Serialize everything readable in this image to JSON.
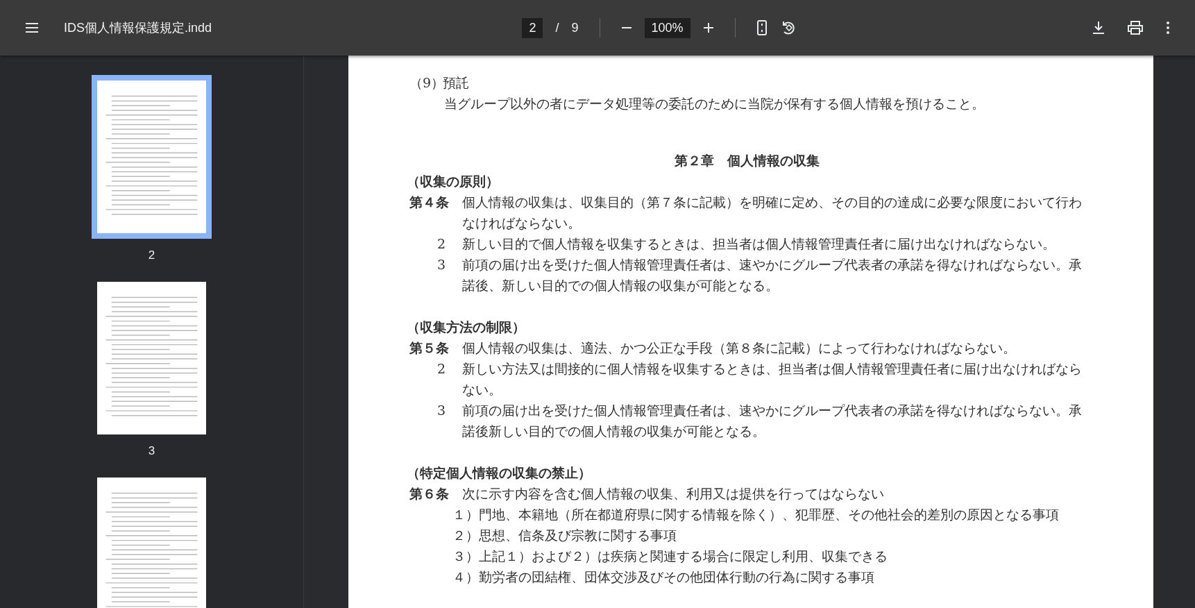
{
  "toolbar": {
    "title": "IDS個人情報保護規定.indd",
    "page_current": "2",
    "page_separator": "/",
    "page_total": "9",
    "zoom": "100%"
  },
  "sidebar": {
    "thumbnails": [
      {
        "label": "2",
        "selected": true
      },
      {
        "label": "3",
        "selected": false
      },
      {
        "selected": false
      }
    ]
  },
  "document": {
    "blocks": [
      {
        "kind": "item",
        "num": "（9）",
        "text": "預託"
      },
      {
        "kind": "para",
        "text": "当グループ以外の者にデータ処理等の委託のために当院が保有する個人情報を預けること。"
      },
      {
        "kind": "chapter",
        "text": "第２章　個人情報の収集"
      },
      {
        "kind": "heading",
        "text": "（収集の原則）"
      },
      {
        "kind": "article",
        "num": "第４条",
        "text": "個人情報の収集は、収集目的（第７条に記載）を明確に定め、その目的の達成に必要な限度において行わなければならない。"
      },
      {
        "kind": "clause",
        "num": "2",
        "text": "新しい目的で個人情報を収集するときは、担当者は個人情報管理責任者に届け出なければならない。"
      },
      {
        "kind": "clause",
        "num": "3",
        "text": "前項の届け出を受けた個人情報管理責任者は、速やかにグループ代表者の承諾を得なければならない。承諾後、新しい目的での個人情報の収集が可能となる。"
      },
      {
        "kind": "heading",
        "text": "（収集方法の制限）"
      },
      {
        "kind": "article",
        "num": "第５条",
        "text": "個人情報の収集は、適法、かつ公正な手段（第８条に記載）によって行わなければならない。"
      },
      {
        "kind": "clause",
        "num": "2",
        "text": "新しい方法又は間接的に個人情報を収集するときは、担当者は個人情報管理責任者に届け出なければならない。"
      },
      {
        "kind": "clause",
        "num": "3",
        "text": "前項の届け出を受けた個人情報管理責任者は、速やかにグループ代表者の承諾を得なければならない。承諾後新しい目的での個人情報の収集が可能となる。"
      },
      {
        "kind": "heading",
        "text": "（特定個人情報の収集の禁止）"
      },
      {
        "kind": "article",
        "num": "第６条",
        "text": "次に示す内容を含む個人情報の収集、利用又は提供を行ってはならない"
      },
      {
        "kind": "list",
        "text": "１）門地、本籍地（所在都道府県に関する情報を除く）、犯罪歴、その他社会的差別の原因となる事項"
      },
      {
        "kind": "list",
        "text": "２）思想、信条及び宗教に関する事項"
      },
      {
        "kind": "list",
        "text": "３）上記１）および２）は疾病と関連する場合に限定し利用、収集できる"
      },
      {
        "kind": "list",
        "text": "４）勤労者の団結権、団体交渉及びその他団体行動の行為に関する事項"
      }
    ]
  }
}
